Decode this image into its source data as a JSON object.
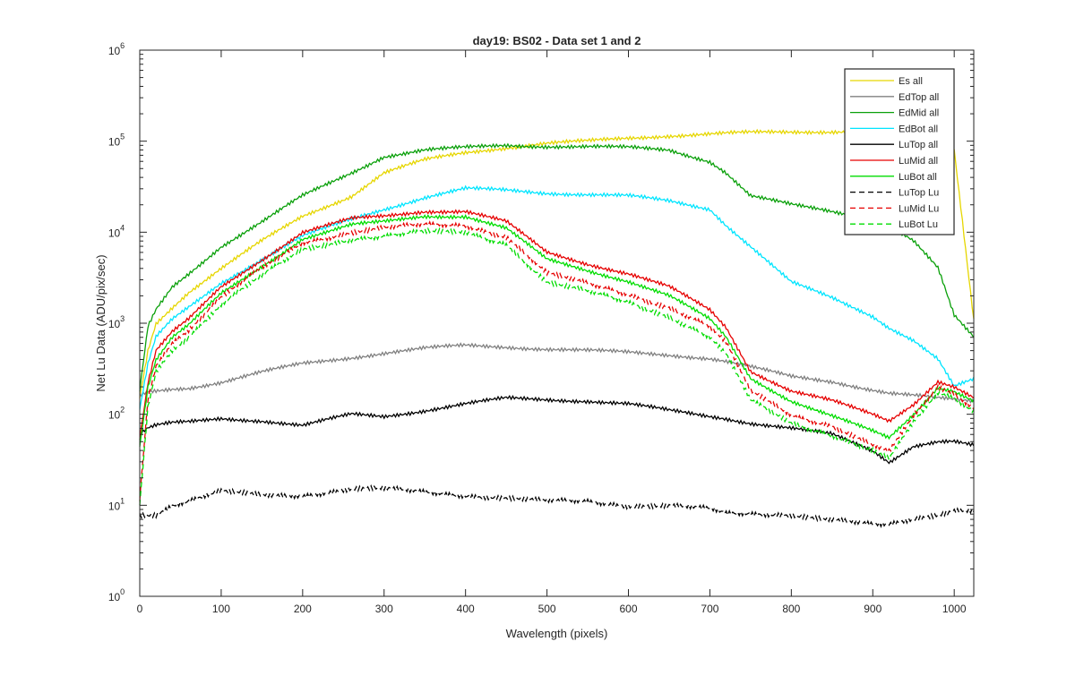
{
  "chart_data": {
    "type": "line",
    "title": "day19: BS02 - Data set 1 and 2",
    "xlabel": "Wavelength (pixels)",
    "ylabel": "Net Lu Data (ADU/pix/sec)",
    "xlim": [
      0,
      1024
    ],
    "ylim": [
      1,
      1000000
    ],
    "yscale": "log",
    "xticks": [
      0,
      100,
      200,
      300,
      400,
      500,
      600,
      700,
      800,
      900,
      1000
    ],
    "xtick_labels": [
      "0",
      "100",
      "200",
      "300",
      "400",
      "500",
      "600",
      "700",
      "800",
      "900",
      "1000"
    ],
    "yticks": [
      1,
      10,
      100,
      1000,
      10000,
      100000,
      1000000
    ],
    "ytick_labels": [
      {
        "base": "10",
        "exp": "0"
      },
      {
        "base": "10",
        "exp": "1"
      },
      {
        "base": "10",
        "exp": "2"
      },
      {
        "base": "10",
        "exp": "3"
      },
      {
        "base": "10",
        "exp": "4"
      },
      {
        "base": "10",
        "exp": "5"
      },
      {
        "base": "10",
        "exp": "6"
      }
    ],
    "grid": false,
    "legend_position": "top-right",
    "x": [
      0,
      10,
      20,
      40,
      60,
      100,
      150,
      200,
      260,
      300,
      350,
      400,
      450,
      500,
      550,
      600,
      650,
      700,
      720,
      750,
      800,
      850,
      900,
      920,
      950,
      980,
      1000,
      1024
    ],
    "series": [
      {
        "name": "Es  all",
        "color": "#e6d600",
        "dash": "solid",
        "values": [
          150,
          500,
          1000,
          1500,
          2200,
          4000,
          8000,
          15000,
          25000,
          45000,
          62000,
          75000,
          85000,
          95000,
          100000,
          108000,
          115000,
          120000,
          122000,
          124000,
          126000,
          128000,
          130000,
          131000,
          131000,
          128000,
          80000,
          1100
        ]
      },
      {
        "name": "EdTop  all",
        "color": "#808080",
        "dash": "solid",
        "values": [
          160,
          175,
          180,
          190,
          195,
          225,
          290,
          360,
          420,
          470,
          530,
          570,
          550,
          520,
          500,
          480,
          450,
          410,
          380,
          330,
          260,
          230,
          185,
          170,
          160,
          150,
          145,
          140
        ]
      },
      {
        "name": "EdMid  all",
        "color": "#0aa00a",
        "dash": "solid",
        "values": [
          180,
          900,
          1400,
          2500,
          3500,
          7000,
          13000,
          25000,
          45000,
          68000,
          80000,
          85000,
          90000,
          88000,
          87000,
          85000,
          80000,
          60000,
          45000,
          25000,
          20000,
          17000,
          14000,
          12000,
          8000,
          4000,
          1200,
          700
        ]
      },
      {
        "name": "EdBot  all",
        "color": "#00e5ff",
        "dash": "solid",
        "values": [
          110,
          350,
          700,
          1100,
          1500,
          2800,
          5000,
          9000,
          14000,
          18000,
          24000,
          30000,
          29000,
          27000,
          26000,
          25000,
          22000,
          18000,
          12000,
          7000,
          2800,
          1900,
          1200,
          900,
          650,
          400,
          200,
          240
        ]
      },
      {
        "name": "LuTop  all",
        "color": "#000000",
        "dash": "solid",
        "values": [
          60,
          70,
          75,
          80,
          82,
          90,
          85,
          75,
          100,
          95,
          110,
          130,
          150,
          145,
          140,
          130,
          110,
          95,
          90,
          80,
          70,
          60,
          40,
          30,
          45,
          50,
          50,
          45
        ]
      },
      {
        "name": "LuMid  all",
        "color": "#e60000",
        "dash": "solid",
        "values": [
          55,
          220,
          500,
          800,
          1100,
          2500,
          5000,
          10000,
          14000,
          15000,
          17000,
          17000,
          13000,
          6000,
          4500,
          3500,
          2500,
          1400,
          900,
          300,
          180,
          140,
          100,
          85,
          130,
          230,
          200,
          150
        ]
      },
      {
        "name": "LuBot  all",
        "color": "#00dd00",
        "dash": "solid",
        "values": [
          45,
          200,
          400,
          700,
          950,
          2100,
          4200,
          8500,
          12000,
          13000,
          15000,
          15000,
          11000,
          5000,
          3800,
          2900,
          2000,
          1100,
          700,
          250,
          140,
          95,
          65,
          55,
          100,
          200,
          180,
          140
        ]
      },
      {
        "name": "LuTop  Lu",
        "color": "#000000",
        "dash": "dashed",
        "values": [
          8,
          8,
          8,
          10,
          11,
          14,
          13,
          13,
          15,
          15,
          14,
          13,
          12,
          11,
          11,
          10,
          10,
          9,
          8,
          8,
          8,
          7,
          6,
          6,
          7,
          8,
          9,
          9
        ]
      },
      {
        "name": "LuMid  Lu",
        "color": "#e60000",
        "dash": "dashed",
        "values": [
          12,
          150,
          350,
          620,
          850,
          1900,
          4000,
          7800,
          10000,
          11000,
          12000,
          12000,
          9000,
          3500,
          2700,
          2100,
          1500,
          900,
          600,
          180,
          100,
          75,
          45,
          38,
          95,
          200,
          170,
          120
        ]
      },
      {
        "name": "LuBot  Lu",
        "color": "#00dd00",
        "dash": "dashed",
        "values": [
          10,
          120,
          300,
          520,
          720,
          1600,
          3300,
          6500,
          8500,
          9000,
          10000,
          10000,
          7500,
          2800,
          2200,
          1700,
          1200,
          700,
          450,
          140,
          80,
          60,
          40,
          32,
          80,
          170,
          150,
          110
        ]
      }
    ]
  }
}
